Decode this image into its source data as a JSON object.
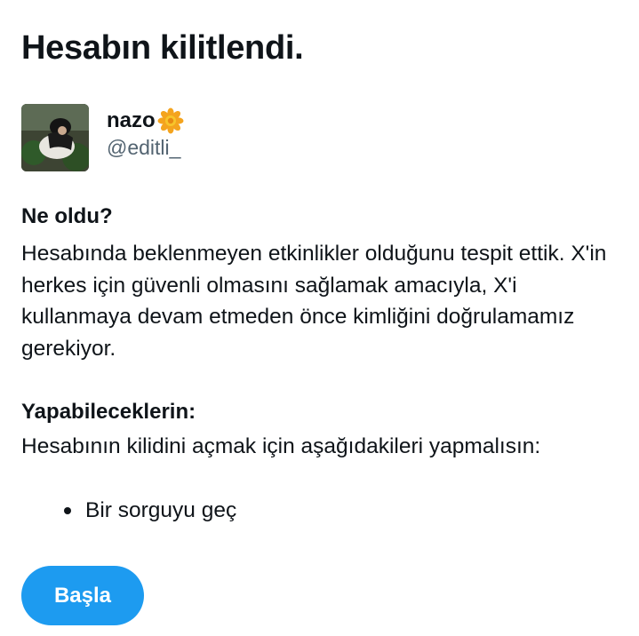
{
  "page": {
    "title": "Hesabın kilitlendi."
  },
  "profile": {
    "display_name": "nazo",
    "display_name_emoji": "flower-icon",
    "handle": "@editli_"
  },
  "what_happened": {
    "heading": "Ne oldu?",
    "body": "Hesabında beklenmeyen etkinlikler olduğunu tespit ettik. X'in herkes için güvenli olmasını sağlamak amacıyla, X'i kullanmaya devam etmeden önce kimliğini doğrulamamız gerekiyor."
  },
  "what_you_can_do": {
    "heading": "Yapabileceklerin:",
    "body": "Hesabının kilidini açmak için aşağıdakileri yapmalısın:",
    "steps": [
      "Bir sorguyu geç"
    ]
  },
  "actions": {
    "start_label": "Başla"
  },
  "colors": {
    "accent": "#1d9bf0",
    "text_primary": "#0f1419",
    "text_secondary": "#536471"
  }
}
